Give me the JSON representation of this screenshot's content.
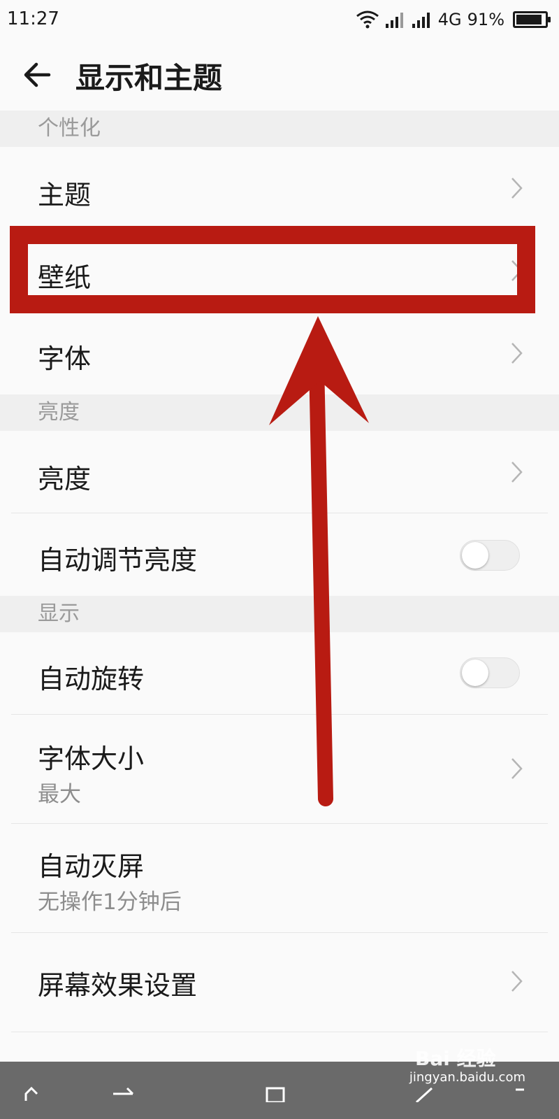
{
  "status_bar": {
    "time": "11:27",
    "network": "4G",
    "battery": "91%",
    "battery_level": 0.91
  },
  "app_bar": {
    "title": "显示和主题",
    "back_icon": "back-arrow-icon"
  },
  "sections": {
    "personalization": {
      "header": "个性化",
      "items": [
        {
          "label": "主题"
        },
        {
          "label": "壁纸"
        },
        {
          "label": "字体"
        }
      ]
    },
    "brightness": {
      "header": "亮度",
      "items": [
        {
          "label": "亮度"
        },
        {
          "label": "自动调节亮度",
          "toggle": false
        }
      ]
    },
    "display": {
      "header": "显示",
      "items": [
        {
          "label": "自动旋转",
          "toggle": false
        },
        {
          "label": "字体大小",
          "sub": "最大"
        },
        {
          "label": "自动灭屏",
          "sub": "无操作1分钟后"
        },
        {
          "label": "屏幕效果设置"
        }
      ]
    }
  },
  "annotation": {
    "color": "#b81b12"
  },
  "watermark": {
    "logo": "Bai 经验",
    "url": "jingyan.baidu.com"
  },
  "colors": {
    "background": "#fafafa",
    "section_bg": "#efefef",
    "navbar": "#6a6a6a"
  }
}
